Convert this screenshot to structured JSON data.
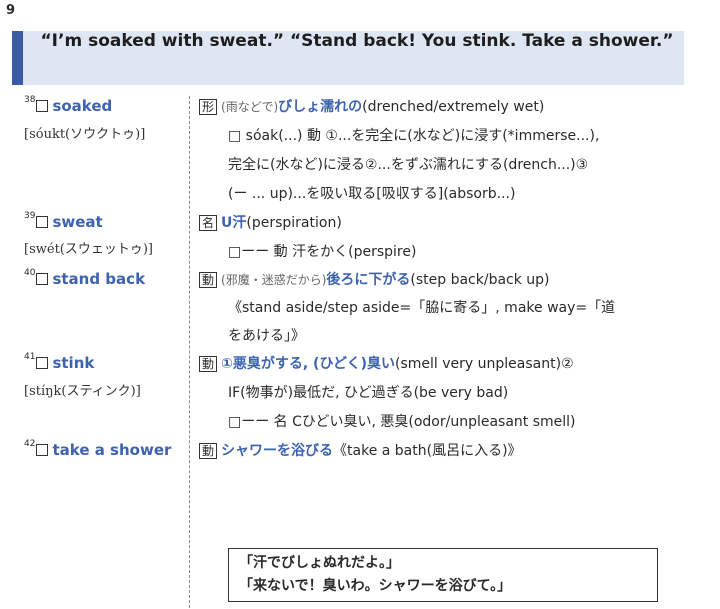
{
  "page_number": "9",
  "header": {
    "quote": "“I’m soaked with sweat.” “Stand back! You stink. Take a shower.”"
  },
  "entries": [
    {
      "num": "38",
      "word": "soaked",
      "pron": "[sóukt(ソウクトゥ)]",
      "lines": [
        {
          "pos": "形",
          "note": "(雨などで)",
          "head": "びしょ濡れの",
          "rest": "(drenched/extremely wet)"
        },
        {
          "text": "□ sóak(...) 動 ①...を完全に(水など)に浸す(*immerse...),"
        },
        {
          "text": "完全に(水など)に浸る②...をずぶ濡れにする(drench...)③"
        },
        {
          "text": "(ー ... up)...を吸い取る[吸収する](absorb...)"
        }
      ]
    },
    {
      "num": "39",
      "word": "sweat",
      "pron": "[swét(スウェットゥ)]",
      "lines": [
        {
          "pos": "名",
          "head": "U汗",
          "rest": "(perspiration)"
        },
        {
          "text": "□ーー 動 汗をかく(perspire)"
        }
      ]
    },
    {
      "num": "40",
      "word": "stand back",
      "pron": "",
      "lines": [
        {
          "pos": "動",
          "note": "(邪魔・迷惑だから)",
          "head": "後ろに下がる",
          "rest": "(step back/back up)"
        },
        {
          "text": "《stand aside/step aside=「脇に寄る」, make way=「道"
        },
        {
          "text": "をあける」》"
        }
      ]
    },
    {
      "num": "41",
      "word": "stink",
      "pron": "[stíŋk(スティンク)]",
      "lines": [
        {
          "pos": "動",
          "head": "①悪臭がする, (ひどく)臭い",
          "rest": "(smell very unpleasant)②"
        },
        {
          "text": "IF(物事が)最低だ, ひど過ぎる(be very bad)"
        },
        {
          "text": "□ーー 名 Cひどい臭い, 悪臭(odor/unpleasant smell)"
        }
      ]
    },
    {
      "num": "42",
      "word": "take a shower",
      "pron": "",
      "lines": [
        {
          "pos": "動",
          "head": "シャワーを浴びる",
          "rest": "《take a bath(風呂に入る)》"
        }
      ]
    }
  ],
  "answer": {
    "line1": "「汗でびしょぬれだよ。」",
    "line2": "「来ないで！臭いわ。シャワーを浴びて。」"
  }
}
